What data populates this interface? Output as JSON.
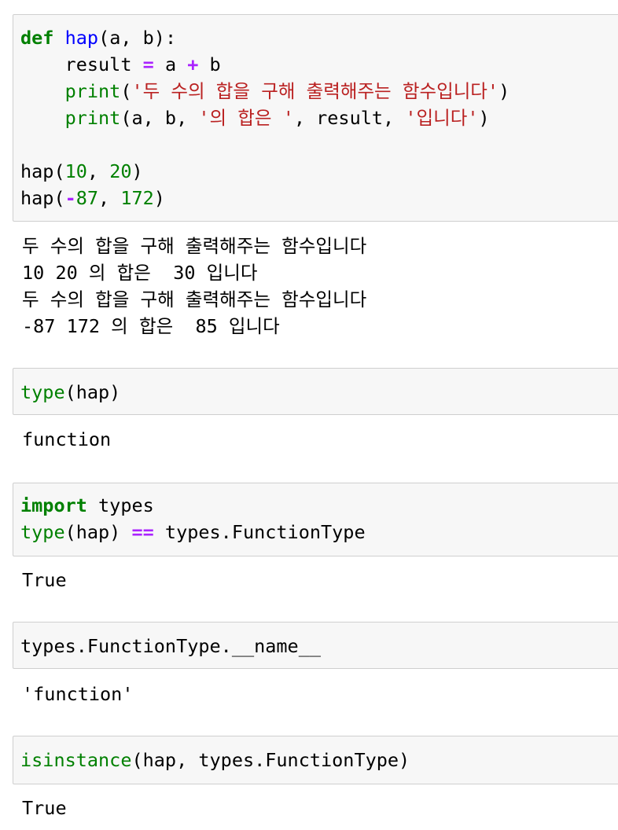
{
  "cells": [
    {
      "code": {
        "l1": {
          "kw": "def",
          "fn": "hap",
          "rest": "(a, b):"
        },
        "l2": {
          "indent": "    ",
          "a": "result ",
          "op": "=",
          "b": " a ",
          "op2": "+",
          "c": " b"
        },
        "l3": {
          "indent": "    ",
          "fn": "print",
          "p1": "(",
          "s": "'두 수의 합을 구해 출력해주는 함수입니다'",
          "p2": ")"
        },
        "l4": {
          "indent": "    ",
          "fn": "print",
          "p1": "(a, b, ",
          "s1": "'의 합은 '",
          "m": ", result, ",
          "s2": "'입니다'",
          "p2": ")"
        },
        "l6": {
          "a": "hap(",
          "n1": "10",
          "c": ", ",
          "n2": "20",
          "b": ")"
        },
        "l7": {
          "a": "hap(",
          "op": "-",
          "n1": "87",
          "c": ", ",
          "n2": "172",
          "b": ")"
        }
      },
      "output": [
        "두 수의 합을 구해 출력해주는 함수입니다",
        "10 20 의 합은  30 입니다",
        "두 수의 합을 구해 출력해주는 함수입니다",
        "-87 172 의 합은  85 입니다"
      ]
    },
    {
      "code": {
        "bi": "type",
        "rest": "(hap)"
      },
      "output": "function"
    },
    {
      "code": {
        "l1": {
          "kw": "import",
          "rest": " types"
        },
        "l2": {
          "bi": "type",
          "a": "(hap) ",
          "op": "==",
          "b": " types.FunctionType"
        }
      },
      "output": "True"
    },
    {
      "code": {
        "text": "types.FunctionType.__name__"
      },
      "output": "'function'"
    },
    {
      "code": {
        "bi": "isinstance",
        "rest": "(hap, types.FunctionType)"
      },
      "output": "True"
    }
  ]
}
